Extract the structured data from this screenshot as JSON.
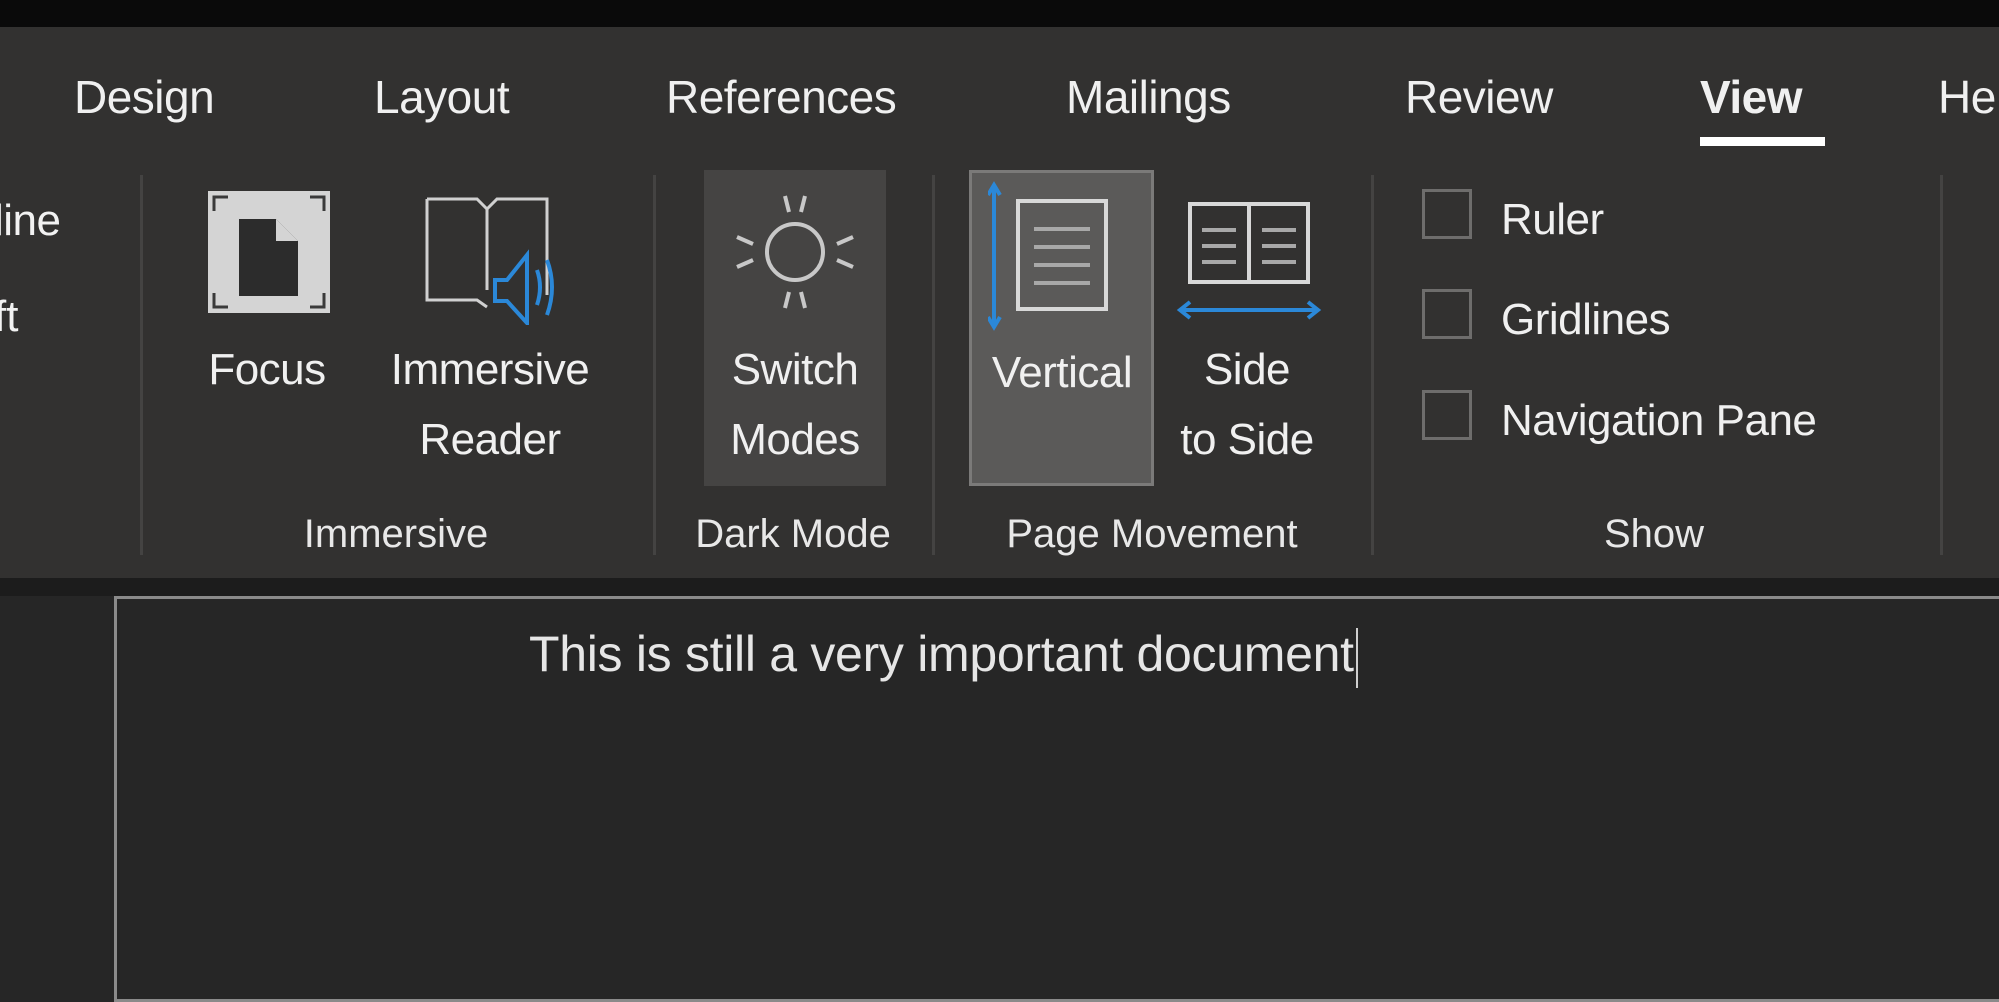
{
  "ribbon": {
    "tabs": [
      {
        "label": "Design"
      },
      {
        "label": "Layout"
      },
      {
        "label": "References"
      },
      {
        "label": "Mailings"
      },
      {
        "label": "Review"
      },
      {
        "label": "View",
        "active": true
      },
      {
        "label": "He"
      }
    ],
    "cut_off_items": [
      "line",
      "ft"
    ],
    "groups": {
      "immersive": {
        "label": "Immersive",
        "focus": {
          "label": "Focus",
          "icon": "focus-icon"
        },
        "immersive_reader": {
          "line1": "Immersive",
          "line2": "Reader",
          "icon": "immersive-reader-icon"
        }
      },
      "dark_mode": {
        "label": "Dark Mode",
        "switch_modes": {
          "line1": "Switch",
          "line2": "Modes",
          "icon": "sun-icon"
        }
      },
      "page_movement": {
        "label": "Page Movement",
        "vertical": {
          "label": "Vertical",
          "icon": "vertical-page-icon",
          "selected": true
        },
        "side_to_side": {
          "line1": "Side",
          "line2": "to Side",
          "icon": "side-to-side-icon"
        }
      },
      "show": {
        "label": "Show",
        "checkboxes": [
          {
            "label": "Ruler",
            "checked": false
          },
          {
            "label": "Gridlines",
            "checked": false
          },
          {
            "label": "Navigation Pane",
            "checked": false
          }
        ]
      }
    }
  },
  "document": {
    "text": "This is still a very important document"
  },
  "colors": {
    "accent": "#2b88d8",
    "ribbon_bg": "#323130",
    "document_bg": "#262626"
  }
}
